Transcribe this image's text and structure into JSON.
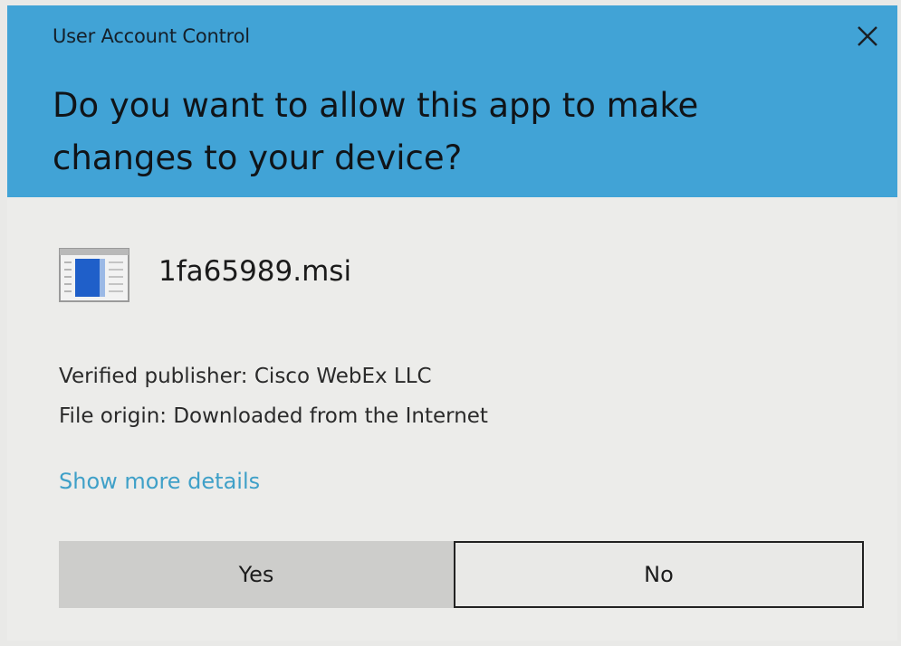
{
  "window": {
    "title": "User Account Control",
    "close_icon": "close-icon"
  },
  "prompt": {
    "question": "Do you want to allow this app to make changes to your device?"
  },
  "app": {
    "icon": "installer-file-icon",
    "name": "1fa65989.msi"
  },
  "details": {
    "publisher": "Verified publisher: Cisco WebEx LLC",
    "origin": "File origin: Downloaded from the Internet",
    "more_link": "Show more details"
  },
  "buttons": {
    "yes_label": "Yes",
    "no_label": "No"
  },
  "colors": {
    "header": "#41a3d6",
    "body": "#ececea",
    "link": "#3fa0c8",
    "yes_button": "#cdcdcb"
  }
}
